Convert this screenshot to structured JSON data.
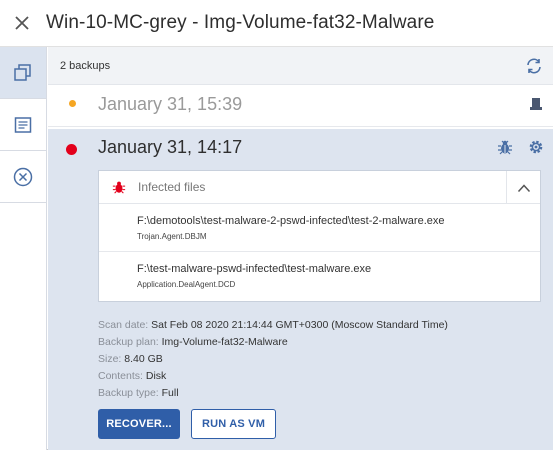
{
  "window": {
    "title": "Win-10-MC-grey - Img-Volume-fat32-Malware"
  },
  "list": {
    "count_label": "2 backups"
  },
  "backups": [
    {
      "date": "January 31, 15:39",
      "status_color": "#f5a623"
    },
    {
      "date": "January 31, 14:17",
      "status_color": "#e3001b"
    }
  ],
  "infected": {
    "header": "Infected files",
    "files": [
      {
        "path": "F:\\demotools\\test-malware-2-pswd-infected\\test-2-malware.exe",
        "threat": "Trojan.Agent.DBJM"
      },
      {
        "path": "F:\\test-malware-pswd-infected\\test-malware.exe",
        "threat": "Application.DealAgent.DCD"
      }
    ]
  },
  "details": {
    "scan_date_label": "Scan date:",
    "scan_date": "Sat Feb 08 2020 21:14:44 GMT+0300 (Moscow Standard Time)",
    "plan_label": "Backup plan:",
    "plan": "Img-Volume-fat32-Malware",
    "size_label": "Size:",
    "size": "8.40 GB",
    "contents_label": "Contents:",
    "contents": "Disk",
    "type_label": "Backup type:",
    "type": "Full"
  },
  "actions": {
    "recover": "RECOVER...",
    "run_vm": "RUN AS VM"
  },
  "colors": {
    "accent": "#2f5ea8",
    "icon": "#4a6fa5",
    "alert": "#e3001b",
    "warn": "#f5a623"
  }
}
